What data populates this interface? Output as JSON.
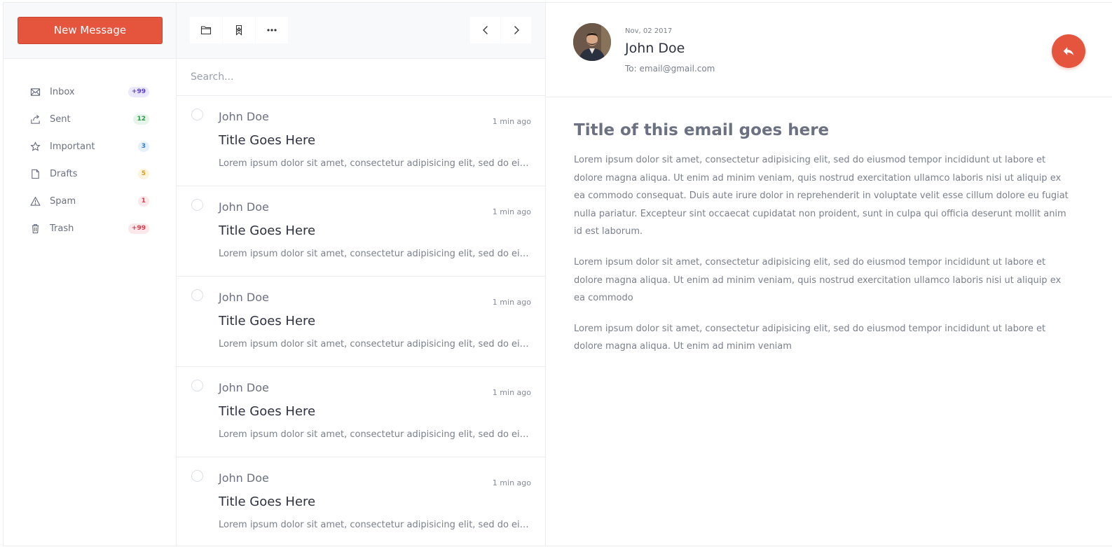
{
  "sidebar": {
    "new_message_label": "New Message",
    "items": [
      {
        "label": "Inbox",
        "icon": "envelope-icon",
        "badge": "+99",
        "badge_bg": "#ece8fb",
        "badge_color": "#5b3fd1"
      },
      {
        "label": "Sent",
        "icon": "share-icon",
        "badge": "12",
        "badge_bg": "#e6f5e9",
        "badge_color": "#2e9a4a"
      },
      {
        "label": "Important",
        "icon": "star-icon",
        "badge": "3",
        "badge_bg": "#e5f0fb",
        "badge_color": "#2f7fd3"
      },
      {
        "label": "Drafts",
        "icon": "file-icon",
        "badge": "5",
        "badge_bg": "#fdf4e0",
        "badge_color": "#e09b19"
      },
      {
        "label": "Spam",
        "icon": "warning-icon",
        "badge": "1",
        "badge_bg": "#fbe8ea",
        "badge_color": "#d83b4a"
      },
      {
        "label": "Trash",
        "icon": "trash-icon",
        "badge": "+99",
        "badge_bg": "#fbe8ea",
        "badge_color": "#d83b4a"
      }
    ]
  },
  "toolbar": {
    "left_icons": [
      "folder-icon",
      "bookmark-icon",
      "more-icon"
    ],
    "right_icons": [
      "chevron-left-icon",
      "chevron-right-icon"
    ]
  },
  "search": {
    "placeholder": "Search..."
  },
  "messages": [
    {
      "from": "John Doe",
      "time": "1 min ago",
      "title": "Title Goes Here",
      "excerpt": "Lorem ipsum dolor sit amet, consectetur adipisicing elit, sed do eiusmod tempor incididunt"
    },
    {
      "from": "John Doe",
      "time": "1 min ago",
      "title": "Title Goes Here",
      "excerpt": "Lorem ipsum dolor sit amet, consectetur adipisicing elit, sed do eiusmod tempor incididunt"
    },
    {
      "from": "John Doe",
      "time": "1 min ago",
      "title": "Title Goes Here",
      "excerpt": "Lorem ipsum dolor sit amet, consectetur adipisicing elit, sed do eiusmod tempor incididunt"
    },
    {
      "from": "John Doe",
      "time": "1 min ago",
      "title": "Title Goes Here",
      "excerpt": "Lorem ipsum dolor sit amet, consectetur adipisicing elit, sed do eiusmod tempor incididunt"
    },
    {
      "from": "John Doe",
      "time": "1 min ago",
      "title": "Title Goes Here",
      "excerpt": "Lorem ipsum dolor sit amet, consectetur adipisicing elit, sed do eiusmod tempor incididunt"
    }
  ],
  "reader": {
    "date": "Nov, 02 2017",
    "sender": "John Doe",
    "to": "To: email@gmail.com",
    "subject": "Title of this email goes here",
    "paragraphs": [
      "Lorem ipsum dolor sit amet, consectetur adipisicing elit, sed do eiusmod tempor incididunt ut labore et dolore magna aliqua. Ut enim ad minim veniam, quis nostrud exercitation ullamco laboris nisi ut aliquip ex ea commodo consequat. Duis aute irure dolor in reprehenderit in voluptate velit esse cillum dolore eu fugiat nulla pariatur. Excepteur sint occaecat cupidatat non proident, sunt in culpa qui officia deserunt mollit anim id est laborum.",
      "Lorem ipsum dolor sit amet, consectetur adipisicing elit, sed do eiusmod tempor incididunt ut labore et dolore magna aliqua. Ut enim ad minim veniam, quis nostrud exercitation ullamco laboris nisi ut aliquip ex ea commodo",
      "Lorem ipsum dolor sit amet, consectetur adipisicing elit, sed do eiusmod tempor incididunt ut labore et dolore magna aliqua. Ut enim ad minim veniam"
    ]
  },
  "colors": {
    "accent": "#e5543d"
  }
}
